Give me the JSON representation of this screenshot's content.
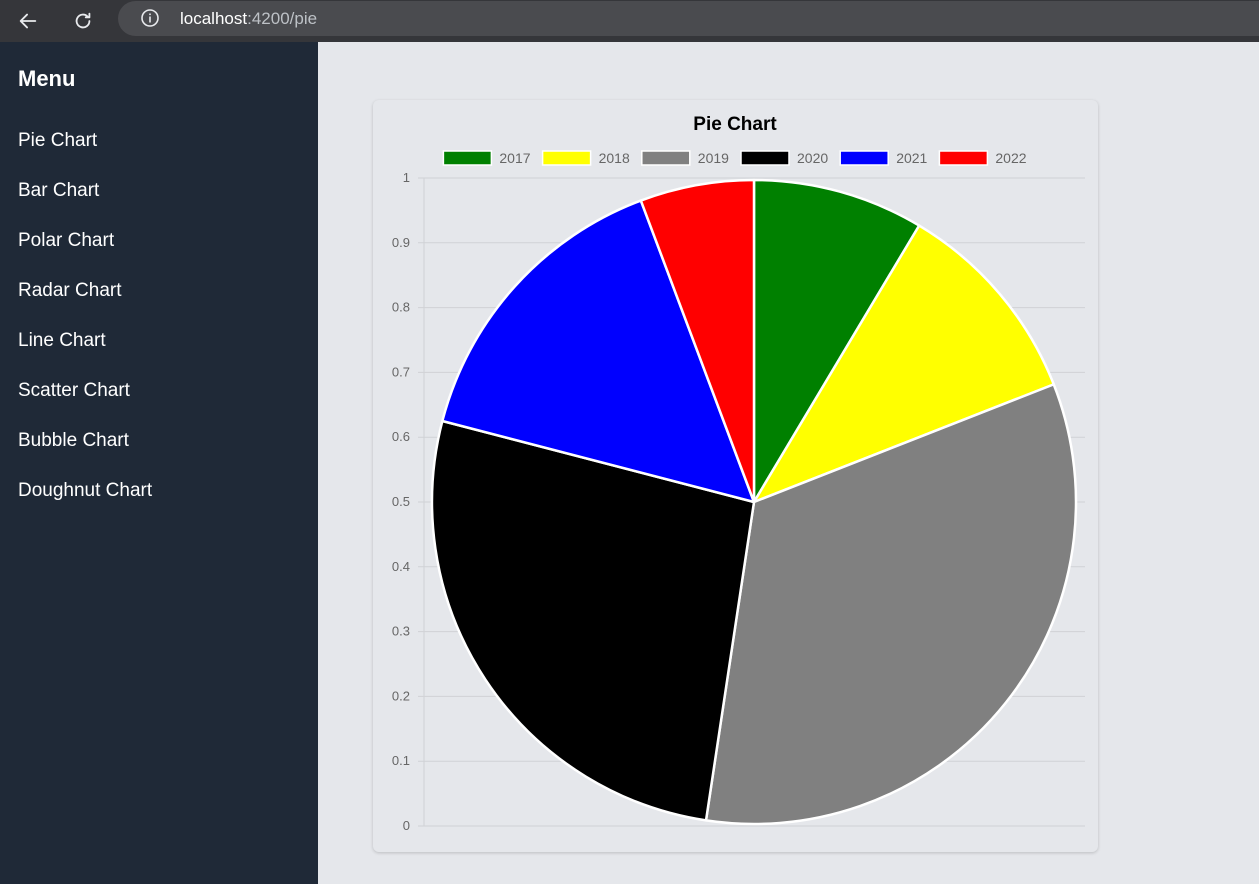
{
  "browser": {
    "back_icon": "arrow-left-icon",
    "reload_icon": "reload-icon",
    "info_icon": "info-circle-icon",
    "url_host": "localhost",
    "url_path": ":4200/pie"
  },
  "sidebar": {
    "title": "Menu",
    "items": [
      {
        "label": "Pie Chart"
      },
      {
        "label": "Bar Chart"
      },
      {
        "label": "Polar Chart"
      },
      {
        "label": "Radar Chart"
      },
      {
        "label": "Line Chart"
      },
      {
        "label": "Scatter Chart"
      },
      {
        "label": "Bubble Chart"
      },
      {
        "label": "Doughnut Chart"
      }
    ]
  },
  "colors": {
    "sidebar_bg": "#1f2937",
    "page_bg": "#e5e7eb"
  },
  "chart_data": {
    "type": "pie",
    "title": "Pie Chart",
    "legend_position": "top",
    "labels": [
      "2017",
      "2018",
      "2019",
      "2020",
      "2021",
      "2022"
    ],
    "values": [
      9,
      11,
      35,
      28,
      16,
      6
    ],
    "colors": [
      "#008000",
      "#ffff00",
      "#808080",
      "#000000",
      "#0000ff",
      "#ff0000"
    ],
    "y_ticks": [
      "1",
      "0.9",
      "0.8",
      "0.7",
      "0.6",
      "0.5",
      "0.4",
      "0.3",
      "0.2",
      "0.1",
      "0"
    ],
    "ylim": [
      0,
      1
    ],
    "grid": true
  }
}
